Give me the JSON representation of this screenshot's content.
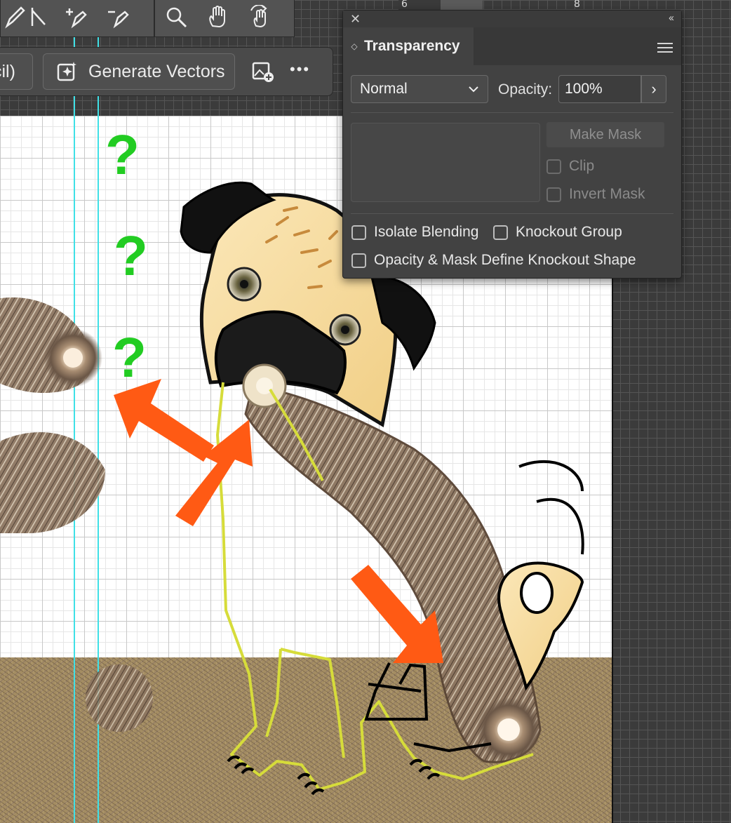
{
  "toolbar": {
    "tools": [
      "pencil-tool-icon",
      "line-tool-icon",
      "add-anchor-point-icon",
      "delete-anchor-point-icon",
      "zoom-icon",
      "hand-icon",
      "rotate-view-icon"
    ]
  },
  "ruler": {
    "marks": [
      "6",
      "8"
    ]
  },
  "taskbar": {
    "prev_label": "cil)",
    "generate_label": "Generate Vectors",
    "more_label": "•••"
  },
  "panel": {
    "close": "✕",
    "collapse": "‹‹",
    "title": "Transparency",
    "blend_mode": "Normal",
    "opacity_label": "Opacity:",
    "opacity_value": "100%",
    "opacity_arrow": "›",
    "make_mask": "Make Mask",
    "clip": "Clip",
    "invert_mask": "Invert Mask",
    "isolate_blending": "Isolate Blending",
    "knockout_group": "Knockout Group",
    "opacity_mask_knockout": "Opacity & Mask Define Knockout Shape"
  },
  "annotations": {
    "question_marks": [
      "?",
      "?",
      "?"
    ]
  },
  "colors": {
    "guide": "#3fe0e6",
    "arrow": "#ff5a14",
    "question": "#22cc22",
    "outline": "#d6dc3a",
    "panel_bg": "#424242"
  }
}
